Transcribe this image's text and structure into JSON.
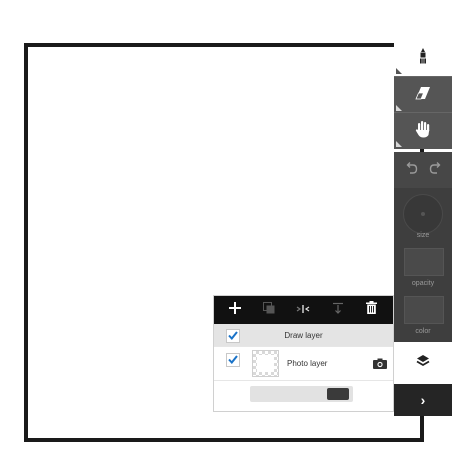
{
  "toolbar": {
    "tools": [
      {
        "name": "pen",
        "icon": "pen-icon"
      },
      {
        "name": "eraser",
        "icon": "eraser-icon"
      },
      {
        "name": "hand",
        "icon": "hand-icon"
      }
    ],
    "history": {
      "undo_icon": "undo-icon",
      "redo_icon": "redo-icon"
    },
    "settings": {
      "size_label": "size",
      "opacity_label": "opacity",
      "color_label": "color"
    },
    "layers_icon": "layers-icon",
    "expand_label": "›"
  },
  "layers_panel": {
    "actions": [
      {
        "name": "add-layer",
        "icon": "plus-icon",
        "label": "+"
      },
      {
        "name": "duplicate-layer",
        "icon": "duplicate-icon"
      },
      {
        "name": "merge-layer",
        "icon": "merge-icon"
      },
      {
        "name": "move-layer-down",
        "icon": "arrow-down-icon"
      },
      {
        "name": "delete-layer",
        "icon": "trash-icon"
      }
    ],
    "layers": [
      {
        "name": "Draw layer",
        "checked": true
      },
      {
        "name": "Photo layer",
        "checked": true
      }
    ]
  },
  "colors": {
    "accent": "#1a73c8",
    "toolbar_dark": "#3e3e3e",
    "panel_header": "#111111"
  }
}
